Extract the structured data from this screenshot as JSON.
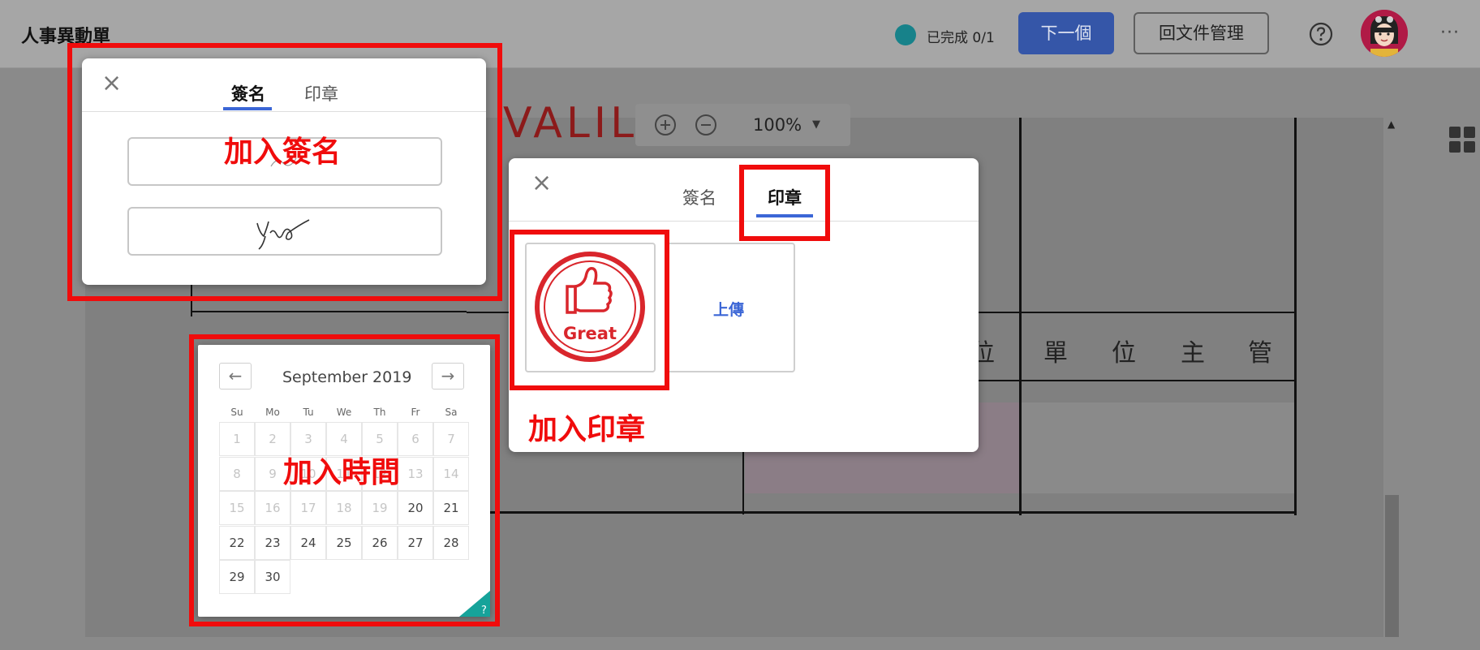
{
  "topbar": {
    "title": "人事異動單",
    "status": "已完成 0/1",
    "next_button": "下一個",
    "back_button": "回文件管理",
    "more": "···",
    "help_icon": "question-circle-icon",
    "avatar_icon": "user-avatar"
  },
  "toolbar": {
    "zoom_value": "100%"
  },
  "document": {
    "header_cells": [
      "單",
      "位",
      "主",
      "管"
    ],
    "partial_header_char": "位",
    "title_fragment": "VALIL"
  },
  "signature_dialog": {
    "tabs": [
      "簽名",
      "印章"
    ],
    "active_tab": "簽名",
    "annotation": "加入簽名"
  },
  "stamp_dialog": {
    "tabs": [
      "簽名",
      "印章"
    ],
    "active_tab": "印章",
    "stamp_text": "Great",
    "upload_label": "上傳",
    "annotation": "加入印章"
  },
  "calendar": {
    "month_label": "September 2019",
    "prev": "←",
    "next": "→",
    "weekdays": [
      "Su",
      "Mo",
      "Tu",
      "We",
      "Th",
      "Fr",
      "Sa"
    ],
    "weeks": [
      [
        "1",
        "2",
        "3",
        "4",
        "5",
        "6",
        "7"
      ],
      [
        "8",
        "9",
        "10",
        "11",
        "12",
        "13",
        "14"
      ],
      [
        "15",
        "16",
        "17",
        "18",
        "19",
        "20",
        "21"
      ],
      [
        "22",
        "23",
        "24",
        "25",
        "26",
        "27",
        "28"
      ],
      [
        "29",
        "30"
      ]
    ],
    "first_enabled_day": 20,
    "annotation": "加入時間",
    "corner_help": "?"
  },
  "colors": {
    "accent": "#3b66d6",
    "annotation_red": "#f00c0c",
    "status_dot": "#17828a",
    "stamp_red": "#d9262c"
  }
}
